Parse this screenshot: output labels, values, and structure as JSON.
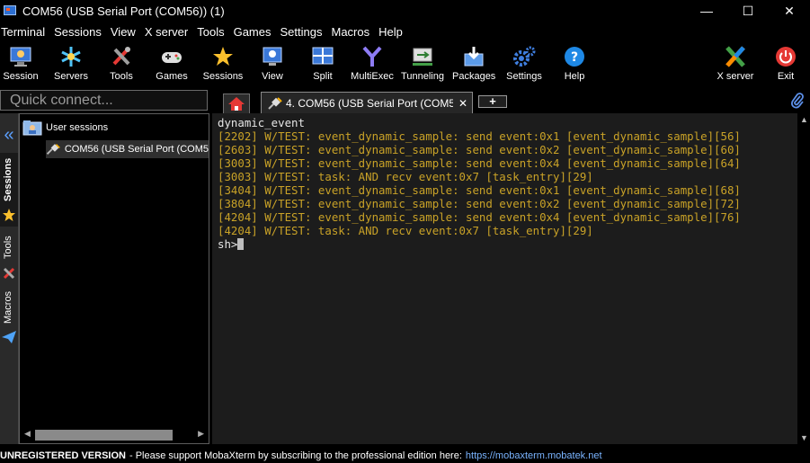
{
  "window": {
    "title": "COM56  (USB Serial Port (COM56)) (1)",
    "minimize": "—",
    "maximize": "☐",
    "close": "✕"
  },
  "menu": [
    "Terminal",
    "Sessions",
    "View",
    "X server",
    "Tools",
    "Games",
    "Settings",
    "Macros",
    "Help"
  ],
  "toolbar": {
    "session": "Session",
    "servers": "Servers",
    "tools": "Tools",
    "games": "Games",
    "sessions": "Sessions",
    "view": "View",
    "split": "Split",
    "multiexec": "MultiExec",
    "tunneling": "Tunneling",
    "packages": "Packages",
    "settings": "Settings",
    "help": "Help",
    "xserver": "X server",
    "exit": "Exit"
  },
  "quick_connect": {
    "placeholder": "Quick connect..."
  },
  "tabs": {
    "active_label": "4. COM56  (USB Serial Port (COM5",
    "close": "✕",
    "add": "+"
  },
  "sidebar": {
    "collapse": "«",
    "sessions_tab": "Sessions",
    "tools_tab": "Tools",
    "macros_tab": "Macros"
  },
  "sessions_panel": {
    "group": "User sessions",
    "item": "COM56  (USB Serial Port (COM5"
  },
  "terminal": {
    "lines": [
      {
        "text": "dynamic_event",
        "color": "white"
      },
      {
        "text": "[2202] W/TEST: event_dynamic_sample: send event:0x1 [event_dynamic_sample][56]",
        "color": "yellow"
      },
      {
        "text": "[2603] W/TEST: event_dynamic_sample: send event:0x2 [event_dynamic_sample][60]",
        "color": "yellow"
      },
      {
        "text": "[3003] W/TEST: event_dynamic_sample: send event:0x4 [event_dynamic_sample][64]",
        "color": "yellow"
      },
      {
        "text": "[3003] W/TEST: task: AND recv event:0x7 [task_entry][29]",
        "color": "yellow"
      },
      {
        "text": "[3404] W/TEST: event_dynamic_sample: send event:0x1 [event_dynamic_sample][68]",
        "color": "yellow"
      },
      {
        "text": "[3804] W/TEST: event_dynamic_sample: send event:0x2 [event_dynamic_sample][72]",
        "color": "yellow"
      },
      {
        "text": "[4204] W/TEST: event_dynamic_sample: send event:0x4 [event_dynamic_sample][76]",
        "color": "yellow"
      },
      {
        "text": "[4204] W/TEST: task: AND recv event:0x7 [task_entry][29]",
        "color": "yellow"
      }
    ],
    "prompt": "sh>"
  },
  "status": {
    "bold": "UNREGISTERED VERSION",
    "message": "-  Please support MobaXterm by subscribing to the professional edition here:",
    "link": "https://mobaxterm.mobatek.net"
  },
  "colors": {
    "terminal_text": "#c9a227",
    "terminal_bg": "#1c1c1c",
    "link": "#7ab4ff"
  }
}
